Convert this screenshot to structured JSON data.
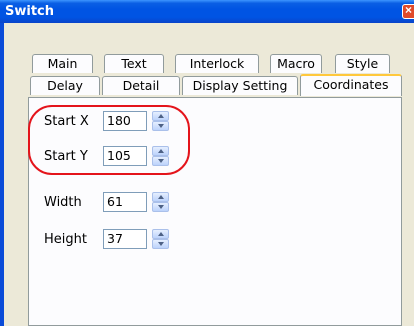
{
  "window": {
    "title": "Switch"
  },
  "tabs_row1": [
    {
      "label": "Main"
    },
    {
      "label": "Text"
    },
    {
      "label": "Interlock"
    },
    {
      "label": "Macro"
    },
    {
      "label": "Style"
    }
  ],
  "tabs_row2": [
    {
      "label": "Delay"
    },
    {
      "label": "Detail"
    },
    {
      "label": "Display Setting"
    },
    {
      "label": "Coordinates",
      "active": true
    }
  ],
  "fields": {
    "start_x": {
      "label": "Start X",
      "value": "180"
    },
    "start_y": {
      "label": "Start Y",
      "value": "105"
    },
    "width": {
      "label": "Width",
      "value": "61"
    },
    "height": {
      "label": "Height",
      "value": "37"
    }
  },
  "annotation": {
    "color": "#e4141b"
  }
}
